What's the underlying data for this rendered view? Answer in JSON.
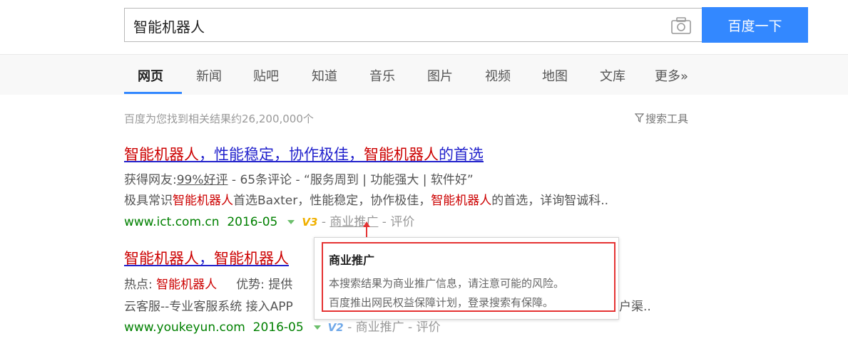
{
  "search": {
    "query": "智能机器人",
    "button_label": "百度一下"
  },
  "nav": {
    "tabs": [
      "网页",
      "新闻",
      "贴吧",
      "知道",
      "音乐",
      "图片",
      "视频",
      "地图",
      "文库",
      "更多»"
    ]
  },
  "results_meta": {
    "count_text": "百度为您找到相关结果约26,200,000个",
    "tools_label": "搜索工具"
  },
  "results": [
    {
      "title_a": "智能机器人",
      "title_b": "，性能稳定，协作极佳，",
      "title_c": "智能机器人",
      "title_d": "的首选",
      "line1_prefix": "获得网友:",
      "line1_rating": "99%好评",
      "line1_rest": " -  65条评论  - “服务周到  |  功能强大  |  软件好”",
      "line2_a": "极具常识",
      "line2_b": "智能机器人",
      "line2_c": "首选Baxter，性能稳定，协作极佳，",
      "line2_d": "智能机器人",
      "line2_e": "的首选，详询智诚科..",
      "url": "www.ict.com.cn",
      "date": "2016-05",
      "badge": "V3",
      "promo": "商业推广",
      "eval": "评价"
    },
    {
      "title_a": "智能机器人",
      "title_b": "，",
      "title_c": "智能机器人",
      "line1_hot_label": "热点: ",
      "line1_hot": "智能机器人",
      "line1_adv": "优势: 提供",
      "line2_a": "云客服--专业客服系统 接入APP",
      "line2_tail": "户渠..",
      "url": "www.youkeyun.com",
      "date": "2016-05",
      "badge": "V2",
      "promo": "商业推广",
      "eval": "评价"
    }
  ],
  "tooltip": {
    "title": "商业推广",
    "line1": "本搜索结果为商业推广信息，请注意可能的风险。",
    "line2": "百度推出网民权益保障计划，登录搜索有保障。"
  },
  "colors": {
    "accent": "#3388ff",
    "link": "#2222cc",
    "highlight": "#cc0000",
    "url": "#008000",
    "annotation": "#e53333"
  }
}
